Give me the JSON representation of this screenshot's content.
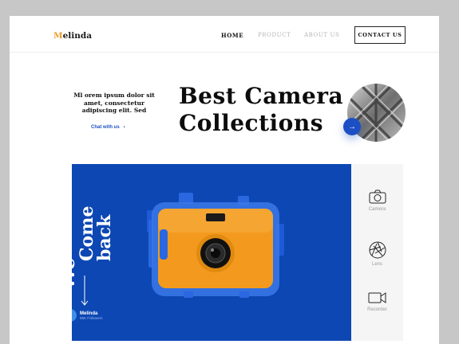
{
  "header": {
    "logo_initial": "M",
    "logo_rest": "elinda",
    "nav": [
      {
        "label": "HOME"
      },
      {
        "label": "PRODUCT"
      },
      {
        "label": "ABOUT US"
      }
    ],
    "contact_label": "CONTACT US"
  },
  "hero": {
    "intro": "Ml orem ipsum dolor sit amet, consectetur adipiscing elit. Sed",
    "chat_label": "Chat with us",
    "headline_line1": "Best Camera",
    "headline_line2": "Collections"
  },
  "showcase": {
    "word1": "We",
    "word2": "Come",
    "word3": "back",
    "author_name": "Melinda",
    "author_sub": "86K Followers"
  },
  "categories": [
    {
      "label": "Camera",
      "icon": "camera-icon"
    },
    {
      "label": "Lens",
      "icon": "aperture-icon"
    },
    {
      "label": "Recorder",
      "icon": "video-icon"
    }
  ],
  "colors": {
    "accent_blue": "#1c4fc4",
    "panel_blue": "#0d47b3",
    "logo_accent": "#e89a2c",
    "camera_orange": "#f39a1e"
  }
}
